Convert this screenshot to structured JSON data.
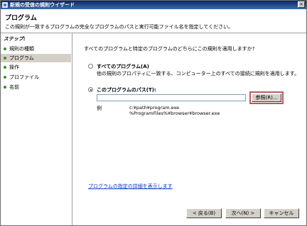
{
  "window": {
    "title": "新規の受信の規則ウイザード",
    "close_glyph": "×"
  },
  "header": {
    "title": "プログラム",
    "description": "この規則が一致するプログラムの完全なプログラムのパスと実行可能ファイル名を指定してください。"
  },
  "sidebar": {
    "steps_title": "ステップ:",
    "items": [
      {
        "label": "規則の種類",
        "active": false
      },
      {
        "label": "プログラム",
        "active": true
      },
      {
        "label": "操作",
        "active": false
      },
      {
        "label": "プロファイル",
        "active": false
      },
      {
        "label": "名前",
        "active": false
      }
    ]
  },
  "main": {
    "question": "すべてのプログラムと特定のプログラムのどちらにこの規則を適用しますか?",
    "option_all": {
      "label": "すべてのプログラム(A)",
      "description": "他の規則のプロパティに一致する、コンピューター上のすべての接続に規則を適用します。",
      "selected": false
    },
    "option_path": {
      "label": "このプログラムのパス(T):",
      "selected": true,
      "value": "",
      "browse_label": "参照(R)..."
    },
    "example": {
      "label": "例",
      "lines": [
        "c:¥path¥program.exe",
        "%ProgramFiles%¥browser¥browser.exe"
      ]
    },
    "link": "プログラムの指定の詳細を表示します"
  },
  "footer": {
    "back_label": "< 戻る(B)",
    "next_label": "次へ(N) >",
    "cancel_label": "キャンセル"
  },
  "colors": {
    "titlebar": "#0a246a",
    "link": "#0a3cbd",
    "highlight": "#b85c5c",
    "step_dot": "#3c8a2e"
  }
}
